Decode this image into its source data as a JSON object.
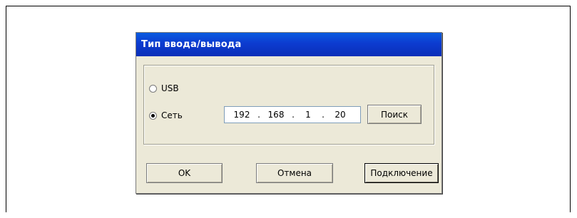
{
  "dialog": {
    "title": "Тип ввода/вывода",
    "options": {
      "usb_label": "USB",
      "network_label": "Сеть",
      "selected": "network"
    },
    "ip_address": [
      "192",
      "168",
      "1",
      "20"
    ],
    "buttons": {
      "search": "Поиск",
      "ok": "OK",
      "cancel": "Отмена",
      "connect": "Подключение"
    }
  },
  "colors": {
    "titlebar": "#0a3cd0",
    "dialog_bg": "#ece9d8",
    "title_text": "#ffffff"
  }
}
